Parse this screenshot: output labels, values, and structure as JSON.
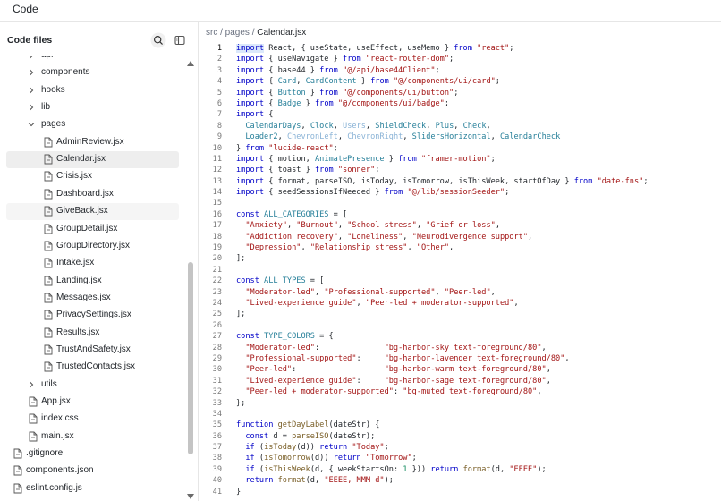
{
  "app": {
    "title": "Code"
  },
  "sidebar": {
    "header": "Code files",
    "items": [
      {
        "label": "api",
        "kind": "folder",
        "depth": 1,
        "open": false
      },
      {
        "label": "components",
        "kind": "folder",
        "depth": 1,
        "open": false
      },
      {
        "label": "hooks",
        "kind": "folder",
        "depth": 1,
        "open": false
      },
      {
        "label": "lib",
        "kind": "folder",
        "depth": 1,
        "open": false
      },
      {
        "label": "pages",
        "kind": "folder",
        "depth": 1,
        "open": true
      },
      {
        "label": "AdminReview.jsx",
        "kind": "file",
        "depth": 2
      },
      {
        "label": "Calendar.jsx",
        "kind": "file",
        "depth": 2,
        "selected": true
      },
      {
        "label": "Crisis.jsx",
        "kind": "file",
        "depth": 2
      },
      {
        "label": "Dashboard.jsx",
        "kind": "file",
        "depth": 2
      },
      {
        "label": "GiveBack.jsx",
        "kind": "file",
        "depth": 2,
        "hovered": true
      },
      {
        "label": "GroupDetail.jsx",
        "kind": "file",
        "depth": 2
      },
      {
        "label": "GroupDirectory.jsx",
        "kind": "file",
        "depth": 2
      },
      {
        "label": "Intake.jsx",
        "kind": "file",
        "depth": 2
      },
      {
        "label": "Landing.jsx",
        "kind": "file",
        "depth": 2
      },
      {
        "label": "Messages.jsx",
        "kind": "file",
        "depth": 2
      },
      {
        "label": "PrivacySettings.jsx",
        "kind": "file",
        "depth": 2
      },
      {
        "label": "Results.jsx",
        "kind": "file",
        "depth": 2
      },
      {
        "label": "TrustAndSafety.jsx",
        "kind": "file",
        "depth": 2
      },
      {
        "label": "TrustedContacts.jsx",
        "kind": "file",
        "depth": 2
      },
      {
        "label": "utils",
        "kind": "folder",
        "depth": 1,
        "open": false
      },
      {
        "label": "App.jsx",
        "kind": "file",
        "depth": 1
      },
      {
        "label": "index.css",
        "kind": "file",
        "depth": 1
      },
      {
        "label": "main.jsx",
        "kind": "file",
        "depth": 1
      },
      {
        "label": ".gitignore",
        "kind": "file",
        "depth": 0
      },
      {
        "label": "components.json",
        "kind": "file",
        "depth": 0
      },
      {
        "label": "eslint.config.js",
        "kind": "file",
        "depth": 0
      }
    ]
  },
  "editor": {
    "breadcrumb": {
      "prefix": "src / pages / ",
      "current": "Calendar.jsx"
    },
    "active_line": 1,
    "lines": [
      [
        [
          "k",
          "import"
        ],
        [
          "p",
          " React, { useState, useEffect, useMemo } "
        ],
        [
          "k",
          "from"
        ],
        [
          "s",
          " \"react\""
        ],
        [
          "p",
          ";"
        ]
      ],
      [
        [
          "k",
          "import"
        ],
        [
          "p",
          " { useNavigate } "
        ],
        [
          "k",
          "from"
        ],
        [
          "s",
          " \"react-router-dom\""
        ],
        [
          "p",
          ";"
        ]
      ],
      [
        [
          "k",
          "import"
        ],
        [
          "p",
          " { base44 } "
        ],
        [
          "k",
          "from"
        ],
        [
          "s",
          " \"@/api/base44Client\""
        ],
        [
          "p",
          ";"
        ]
      ],
      [
        [
          "k",
          "import"
        ],
        [
          "p",
          " { "
        ],
        [
          "c",
          "Card"
        ],
        [
          "p",
          ", "
        ],
        [
          "c",
          "CardContent"
        ],
        [
          "p",
          " } "
        ],
        [
          "k",
          "from"
        ],
        [
          "s",
          " \"@/components/ui/card\""
        ],
        [
          "p",
          ";"
        ]
      ],
      [
        [
          "k",
          "import"
        ],
        [
          "p",
          " { "
        ],
        [
          "c",
          "Button"
        ],
        [
          "p",
          " } "
        ],
        [
          "k",
          "from"
        ],
        [
          "s",
          " \"@/components/ui/button\""
        ],
        [
          "p",
          ";"
        ]
      ],
      [
        [
          "k",
          "import"
        ],
        [
          "p",
          " { "
        ],
        [
          "c",
          "Badge"
        ],
        [
          "p",
          " } "
        ],
        [
          "k",
          "from"
        ],
        [
          "s",
          " \"@/components/ui/badge\""
        ],
        [
          "p",
          ";"
        ]
      ],
      [
        [
          "k",
          "import"
        ],
        [
          "p",
          " {"
        ]
      ],
      [
        [
          "p",
          "  "
        ],
        [
          "c",
          "CalendarDays"
        ],
        [
          "p",
          ", "
        ],
        [
          "c",
          "Clock"
        ],
        [
          "p",
          ", "
        ],
        [
          "dim",
          "Users"
        ],
        [
          "p",
          ", "
        ],
        [
          "c",
          "ShieldCheck"
        ],
        [
          "p",
          ", "
        ],
        [
          "c",
          "Plus"
        ],
        [
          "p",
          ", "
        ],
        [
          "c",
          "Check"
        ],
        [
          "p",
          ","
        ]
      ],
      [
        [
          "p",
          "  "
        ],
        [
          "c",
          "Loader2"
        ],
        [
          "p",
          ", "
        ],
        [
          "dim",
          "ChevronLeft"
        ],
        [
          "p",
          ", "
        ],
        [
          "dim",
          "ChevronRight"
        ],
        [
          "p",
          ", "
        ],
        [
          "c",
          "SlidersHorizontal"
        ],
        [
          "p",
          ", "
        ],
        [
          "c",
          "CalendarCheck"
        ]
      ],
      [
        [
          "p",
          "} "
        ],
        [
          "k",
          "from"
        ],
        [
          "s",
          " \"lucide-react\""
        ],
        [
          "p",
          ";"
        ]
      ],
      [
        [
          "k",
          "import"
        ],
        [
          "p",
          " { motion, "
        ],
        [
          "c",
          "AnimatePresence"
        ],
        [
          "p",
          " } "
        ],
        [
          "k",
          "from"
        ],
        [
          "s",
          " \"framer-motion\""
        ],
        [
          "p",
          ";"
        ]
      ],
      [
        [
          "k",
          "import"
        ],
        [
          "p",
          " { toast } "
        ],
        [
          "k",
          "from"
        ],
        [
          "s",
          " \"sonner\""
        ],
        [
          "p",
          ";"
        ]
      ],
      [
        [
          "k",
          "import"
        ],
        [
          "p",
          " { format, parseISO, isToday, isTomorrow, isThisWeek, startOfDay } "
        ],
        [
          "k",
          "from"
        ],
        [
          "s",
          " \"date-fns\""
        ],
        [
          "p",
          ";"
        ]
      ],
      [
        [
          "k",
          "import"
        ],
        [
          "p",
          " { seedSessionsIfNeeded } "
        ],
        [
          "k",
          "from"
        ],
        [
          "s",
          " \"@/lib/sessionSeeder\""
        ],
        [
          "p",
          ";"
        ]
      ],
      [],
      [
        [
          "k",
          "const"
        ],
        [
          "c",
          " ALL_CATEGORIES"
        ],
        [
          "p",
          " = ["
        ]
      ],
      [
        [
          "p",
          "  "
        ],
        [
          "s",
          "\"Anxiety\""
        ],
        [
          "p",
          ", "
        ],
        [
          "s",
          "\"Burnout\""
        ],
        [
          "p",
          ", "
        ],
        [
          "s",
          "\"School stress\""
        ],
        [
          "p",
          ", "
        ],
        [
          "s",
          "\"Grief or loss\""
        ],
        [
          "p",
          ","
        ]
      ],
      [
        [
          "p",
          "  "
        ],
        [
          "s",
          "\"Addiction recovery\""
        ],
        [
          "p",
          ", "
        ],
        [
          "s",
          "\"Loneliness\""
        ],
        [
          "p",
          ", "
        ],
        [
          "s",
          "\"Neurodivergence support\""
        ],
        [
          "p",
          ","
        ]
      ],
      [
        [
          "p",
          "  "
        ],
        [
          "s",
          "\"Depression\""
        ],
        [
          "p",
          ", "
        ],
        [
          "s",
          "\"Relationship stress\""
        ],
        [
          "p",
          ", "
        ],
        [
          "s",
          "\"Other\""
        ],
        [
          "p",
          ","
        ]
      ],
      [
        [
          "p",
          "];"
        ]
      ],
      [],
      [
        [
          "k",
          "const"
        ],
        [
          "c",
          " ALL_TYPES"
        ],
        [
          "p",
          " = ["
        ]
      ],
      [
        [
          "p",
          "  "
        ],
        [
          "s",
          "\"Moderator-led\""
        ],
        [
          "p",
          ", "
        ],
        [
          "s",
          "\"Professional-supported\""
        ],
        [
          "p",
          ", "
        ],
        [
          "s",
          "\"Peer-led\""
        ],
        [
          "p",
          ","
        ]
      ],
      [
        [
          "p",
          "  "
        ],
        [
          "s",
          "\"Lived-experience guide\""
        ],
        [
          "p",
          ", "
        ],
        [
          "s",
          "\"Peer-led + moderator-supported\""
        ],
        [
          "p",
          ","
        ]
      ],
      [
        [
          "p",
          "];"
        ]
      ],
      [],
      [
        [
          "k",
          "const"
        ],
        [
          "c",
          " TYPE_COLORS"
        ],
        [
          "p",
          " = {"
        ]
      ],
      [
        [
          "p",
          "  "
        ],
        [
          "s",
          "\"Moderator-led\""
        ],
        [
          "p",
          ":              "
        ],
        [
          "s",
          "\"bg-harbor-sky text-foreground/80\""
        ],
        [
          "p",
          ","
        ]
      ],
      [
        [
          "p",
          "  "
        ],
        [
          "s",
          "\"Professional-supported\""
        ],
        [
          "p",
          ":     "
        ],
        [
          "s",
          "\"bg-harbor-lavender text-foreground/80\""
        ],
        [
          "p",
          ","
        ]
      ],
      [
        [
          "p",
          "  "
        ],
        [
          "s",
          "\"Peer-led\""
        ],
        [
          "p",
          ":                   "
        ],
        [
          "s",
          "\"bg-harbor-warm text-foreground/80\""
        ],
        [
          "p",
          ","
        ]
      ],
      [
        [
          "p",
          "  "
        ],
        [
          "s",
          "\"Lived-experience guide\""
        ],
        [
          "p",
          ":     "
        ],
        [
          "s",
          "\"bg-harbor-sage text-foreground/80\""
        ],
        [
          "p",
          ","
        ]
      ],
      [
        [
          "p",
          "  "
        ],
        [
          "s",
          "\"Peer-led + moderator-supported\""
        ],
        [
          "p",
          ": "
        ],
        [
          "s",
          "\"bg-muted text-foreground/80\""
        ],
        [
          "p",
          ","
        ]
      ],
      [
        [
          "p",
          "};"
        ]
      ],
      [],
      [
        [
          "k",
          "function"
        ],
        [
          "f",
          " getDayLabel"
        ],
        [
          "p",
          "(dateStr) {"
        ]
      ],
      [
        [
          "k",
          "  const"
        ],
        [
          "p",
          " d = "
        ],
        [
          "f",
          "parseISO"
        ],
        [
          "p",
          "(dateStr);"
        ]
      ],
      [
        [
          "k",
          "  if"
        ],
        [
          "p",
          " ("
        ],
        [
          "f",
          "isToday"
        ],
        [
          "p",
          "(d)) "
        ],
        [
          "k",
          "return"
        ],
        [
          "s",
          " \"Today\""
        ],
        [
          "p",
          ";"
        ]
      ],
      [
        [
          "k",
          "  if"
        ],
        [
          "p",
          " ("
        ],
        [
          "f",
          "isTomorrow"
        ],
        [
          "p",
          "(d)) "
        ],
        [
          "k",
          "return"
        ],
        [
          "s",
          " \"Tomorrow\""
        ],
        [
          "p",
          ";"
        ]
      ],
      [
        [
          "k",
          "  if"
        ],
        [
          "p",
          " ("
        ],
        [
          "f",
          "isThisWeek"
        ],
        [
          "p",
          "(d, { weekStartsOn: "
        ],
        [
          "n",
          "1"
        ],
        [
          "p",
          " })) "
        ],
        [
          "k",
          "return"
        ],
        [
          "f",
          " format"
        ],
        [
          "p",
          "(d, "
        ],
        [
          "s",
          "\"EEEE\""
        ],
        [
          "p",
          ");"
        ]
      ],
      [
        [
          "k",
          "  return"
        ],
        [
          "f",
          " format"
        ],
        [
          "p",
          "(d, "
        ],
        [
          "s",
          "\"EEEE, MMM d\""
        ],
        [
          "p",
          ");"
        ]
      ],
      [
        [
          "p",
          "}"
        ]
      ]
    ]
  }
}
